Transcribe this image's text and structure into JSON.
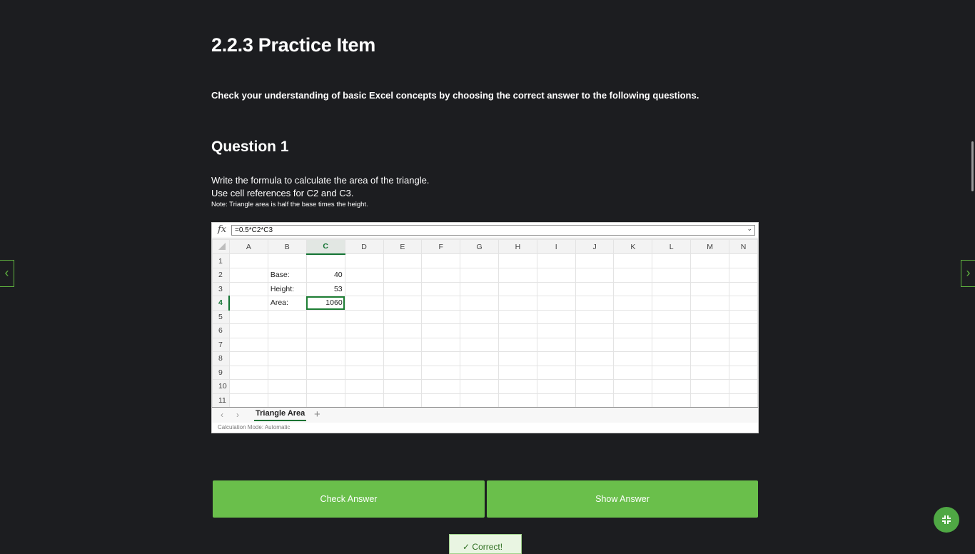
{
  "page": {
    "title": "2.2.3 Practice Item",
    "intro": "Check your understanding of basic Excel concepts by choosing the correct answer to the following questions."
  },
  "question": {
    "heading": "Question 1",
    "line1": "Write the formula to calculate the area of the triangle.",
    "line2": "Use cell references for C2 and C3.",
    "note": "Note: Triangle area is half the base times the height."
  },
  "sheet": {
    "fx_label": "fx",
    "formula": "=0.5*C2*C3",
    "columns": [
      "A",
      "B",
      "C",
      "D",
      "E",
      "F",
      "G",
      "H",
      "I",
      "J",
      "K",
      "L",
      "M",
      "N"
    ],
    "rows": [
      "1",
      "2",
      "3",
      "4",
      "5",
      "6",
      "7",
      "8",
      "9",
      "10",
      "11"
    ],
    "cells": {
      "B2": "Base:",
      "C2": "40",
      "B3": "Height:",
      "C3": "53",
      "B4": "Area:",
      "C4": "1060"
    },
    "active_cell": "C4",
    "tab_name": "Triangle Area",
    "status": "Calculation Mode: Automatic"
  },
  "buttons": {
    "check": "Check Answer",
    "show": "Show Answer"
  },
  "toast": "Correct!",
  "icons": {
    "prev": "chevron-left-icon",
    "next": "chevron-right-icon",
    "fab": "collapse-icon"
  },
  "colors": {
    "background": "#1c1d20",
    "accent": "#6abf4b",
    "sheet_green": "#137333"
  }
}
